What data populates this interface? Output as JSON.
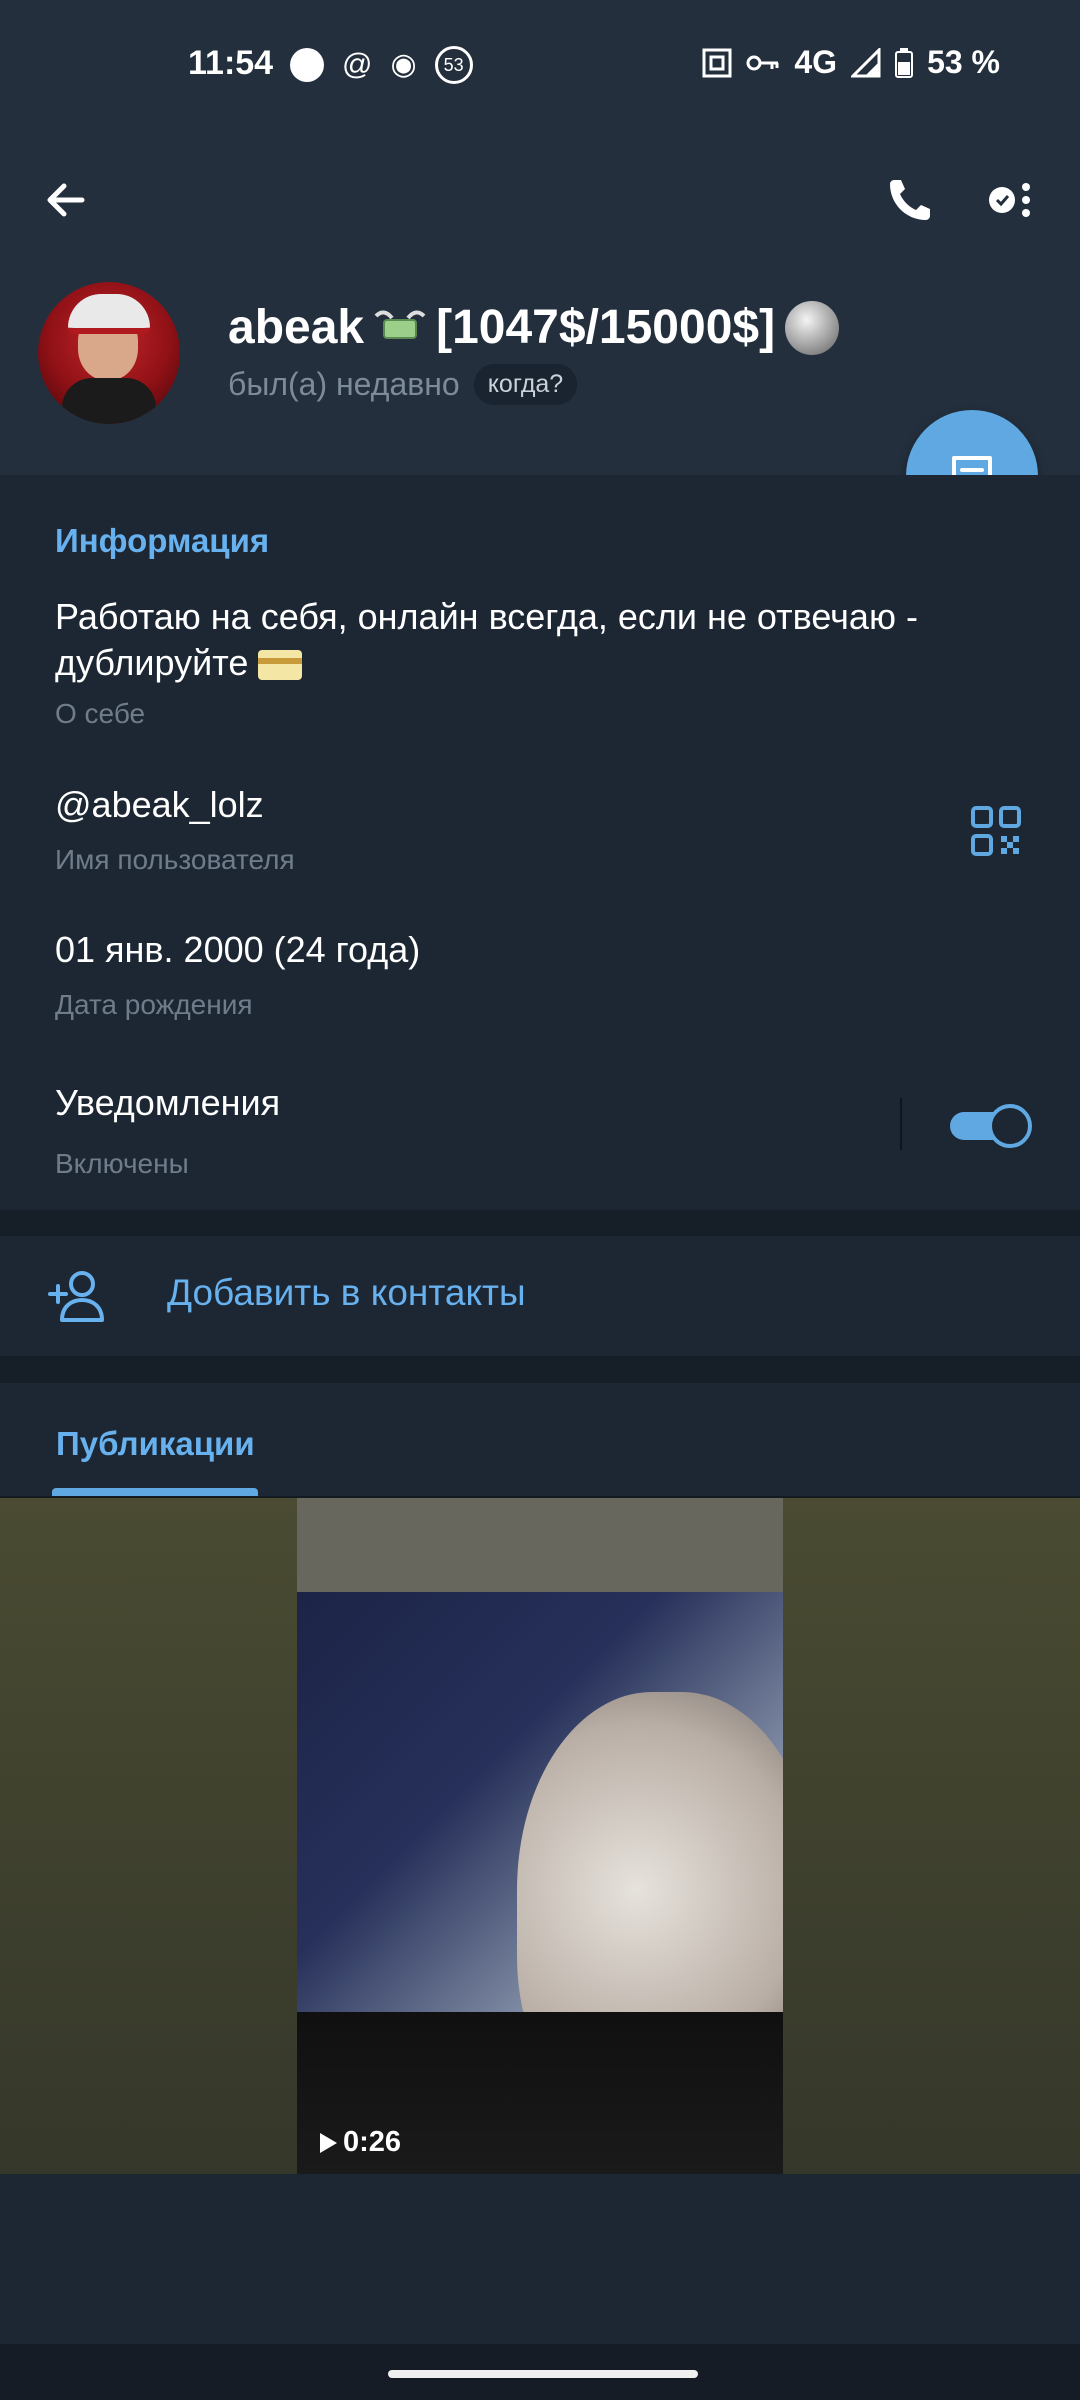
{
  "status_bar": {
    "time": "11:54",
    "network": "4G",
    "battery": "53 %",
    "notification_count": "53"
  },
  "profile": {
    "name": "abeak",
    "name_suffix": "[1047$/15000$]",
    "last_seen": "был(а) недавно",
    "when_label": "когда?"
  },
  "info": {
    "section_title": "Информация",
    "bio": "Работаю на себя, онлайн всегда, если не отвечаю - дублируйте",
    "bio_label": "О себе",
    "username": "@abeak_lolz",
    "username_label": "Имя пользователя",
    "birthday": "01 янв. 2000 (24 года)",
    "birthday_label": "Дата рождения",
    "notifications": "Уведомления",
    "notifications_status": "Включены",
    "notifications_enabled": true
  },
  "actions": {
    "add_contact": "Добавить в контакты"
  },
  "media": {
    "tab_label": "Публикации",
    "video_duration": "0:26"
  },
  "colors": {
    "accent": "#68b1ef",
    "fab": "#5fa8e2",
    "background": "#1d2733",
    "header": "#242f3d"
  },
  "icons": [
    "back-arrow-icon",
    "phone-icon",
    "more-icon",
    "message-icon",
    "qr-code-icon",
    "add-user-icon",
    "play-icon"
  ]
}
